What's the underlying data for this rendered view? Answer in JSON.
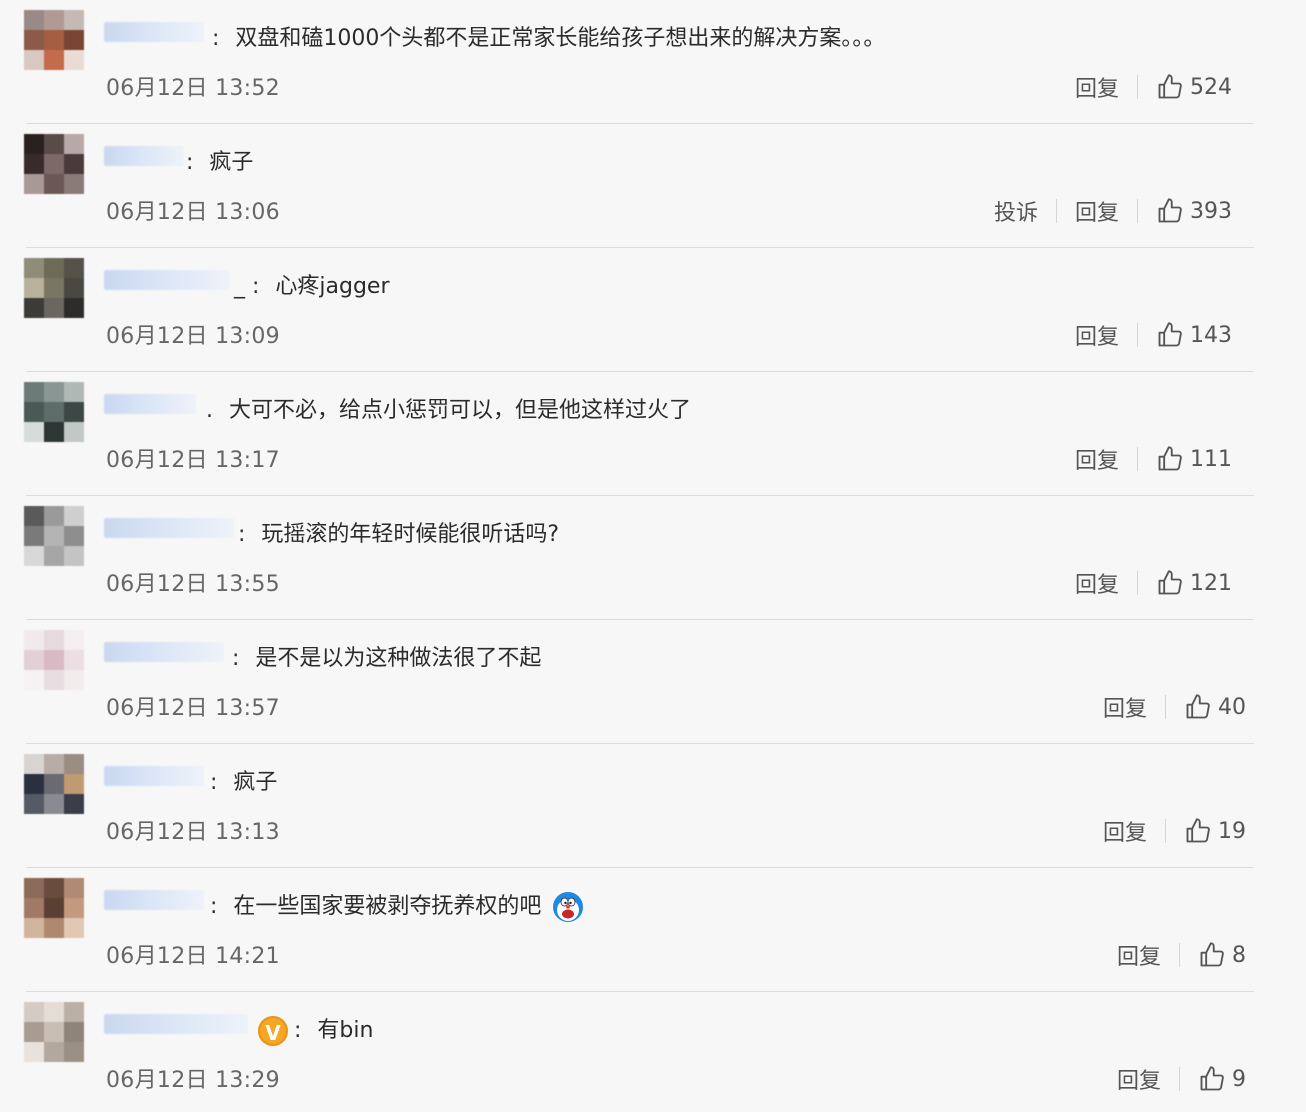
{
  "labels": {
    "reply": "回复",
    "report": "投诉"
  },
  "comments": [
    {
      "text": "双盘和磕1000个头都不是正常家长能给孩子想出来的解决方案。。。",
      "time": "06月12日 13:52",
      "likes": "524"
    },
    {
      "text": "疯子",
      "time": "06月12日 13:06",
      "likes": "393"
    },
    {
      "text": "心疼jagger",
      "time": "06月12日 13:09",
      "likes": "143"
    },
    {
      "text": "大可不必，给点小惩罚可以，但是他这样过火了",
      "time": "06月12日 13:17",
      "likes": "111"
    },
    {
      "text": "玩摇滚的年轻时候能很听话吗?",
      "time": "06月12日 13:55",
      "likes": "121"
    },
    {
      "text": "是不是以为这种做法很了不起",
      "time": "06月12日 13:57",
      "likes": "40"
    },
    {
      "text": "疯子",
      "time": "06月12日 13:13",
      "likes": "19"
    },
    {
      "text": "在一些国家要被剥夺抚养权的吧",
      "time": "06月12日 14:21",
      "likes": "8"
    },
    {
      "text": "有bin",
      "time": "06月12日 13:29",
      "likes": "9"
    }
  ],
  "colors": {
    "background": "#f7f7f7",
    "text": "#2b2b2b",
    "meta": "#666666",
    "divider": "#dcdcdc",
    "username_blur": "#c9d8f0",
    "verified_badge": "#f5a623"
  },
  "icons": {
    "like": "thumbs-up-icon",
    "verified": "verified-v-badge-icon",
    "emoji": "doraemon-emoji-icon"
  }
}
